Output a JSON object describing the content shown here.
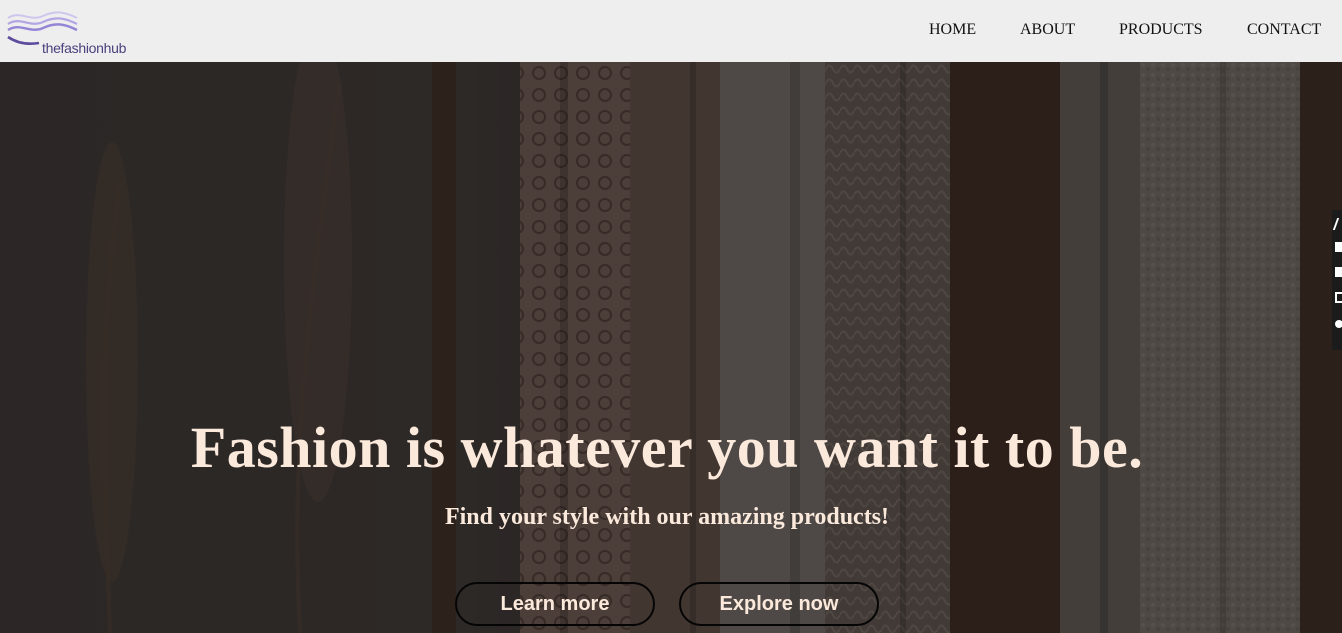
{
  "brand": {
    "logo_text": "thefashionhub"
  },
  "nav": {
    "items": [
      {
        "label": "HOME"
      },
      {
        "label": "ABOUT"
      },
      {
        "label": "PRODUCTS"
      },
      {
        "label": "CONTACT"
      }
    ]
  },
  "hero": {
    "title": "Fashion is whatever you want it to be.",
    "subtitle": "Find your style with our amazing products!",
    "learn_more_label": "Learn more",
    "explore_label": "Explore now"
  },
  "side_toolbar": {
    "icons": [
      "edit-icon",
      "screen-icon",
      "square-icon",
      "copy-icon",
      "settings-icon"
    ]
  },
  "colors": {
    "navbar_bg": "#eeeeee",
    "hero_text": "#fbe9dc",
    "logo_accent": "#7b6bc2"
  }
}
